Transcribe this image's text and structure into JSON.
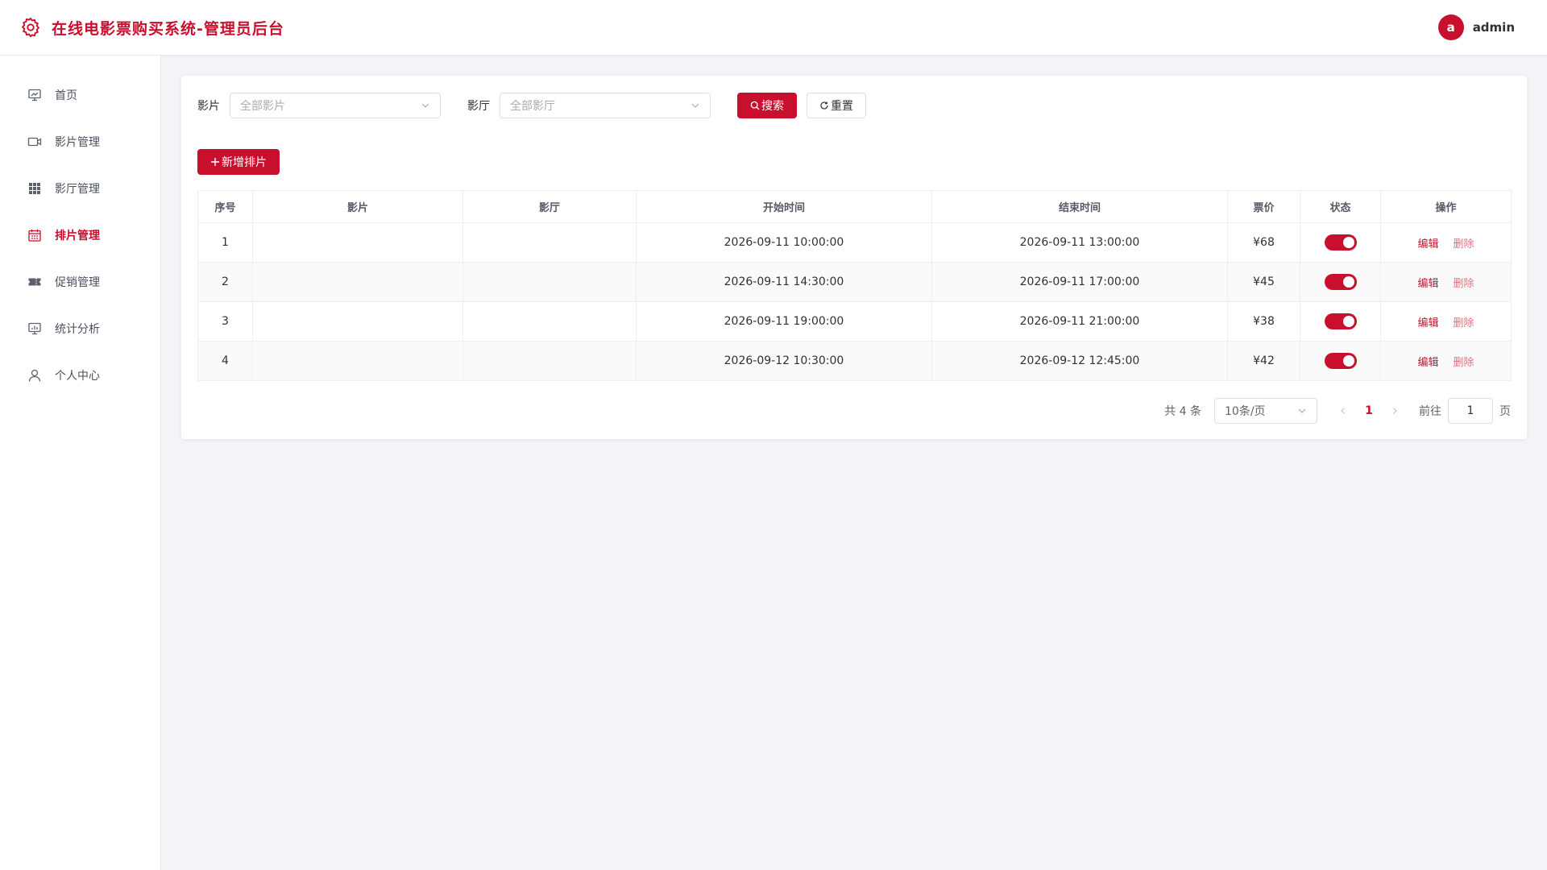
{
  "app": {
    "title": "在线电影票购买系统-管理员后台",
    "user": {
      "avatar_letter": "a",
      "name": "admin"
    },
    "brand_color": "#c8102e"
  },
  "sidebar": {
    "items": [
      {
        "label": "首页",
        "icon": "dashboard-icon",
        "active": false
      },
      {
        "label": "影片管理",
        "icon": "video-camera-icon",
        "active": false
      },
      {
        "label": "影厅管理",
        "icon": "grid-icon",
        "active": false
      },
      {
        "label": "排片管理",
        "icon": "calendar-icon",
        "active": true
      },
      {
        "label": "促销管理",
        "icon": "ticket-icon",
        "active": false
      },
      {
        "label": "统计分析",
        "icon": "chart-board-icon",
        "active": false
      },
      {
        "label": "个人中心",
        "icon": "user-icon",
        "active": false
      }
    ]
  },
  "filters": {
    "movie_label": "影片",
    "movie_placeholder": "全部影片",
    "hall_label": "影厅",
    "hall_placeholder": "全部影厅",
    "search_label": "搜索",
    "reset_label": "重置"
  },
  "actions": {
    "add_label": "新增排片"
  },
  "table": {
    "columns": [
      "序号",
      "影片",
      "影厅",
      "开始时间",
      "结束时间",
      "票价",
      "状态",
      "操作"
    ],
    "rows": [
      {
        "index": "1",
        "movie": "",
        "hall": "",
        "start": "2026-09-11 10:00:00",
        "end": "2026-09-11 13:00:00",
        "price": "¥68",
        "enabled": true
      },
      {
        "index": "2",
        "movie": "",
        "hall": "",
        "start": "2026-09-11 14:30:00",
        "end": "2026-09-11 17:00:00",
        "price": "¥45",
        "enabled": true
      },
      {
        "index": "3",
        "movie": "",
        "hall": "",
        "start": "2026-09-11 19:00:00",
        "end": "2026-09-11 21:00:00",
        "price": "¥38",
        "enabled": true
      },
      {
        "index": "4",
        "movie": "",
        "hall": "",
        "start": "2026-09-12 10:30:00",
        "end": "2026-09-12 12:45:00",
        "price": "¥42",
        "enabled": true
      }
    ],
    "edit_label": "编辑",
    "delete_label": "删除"
  },
  "pagination": {
    "total_text": "共 4 条",
    "page_size": "10条/页",
    "current_page": "1",
    "goto_label": "前往",
    "goto_value": "1",
    "goto_suffix": "页"
  }
}
